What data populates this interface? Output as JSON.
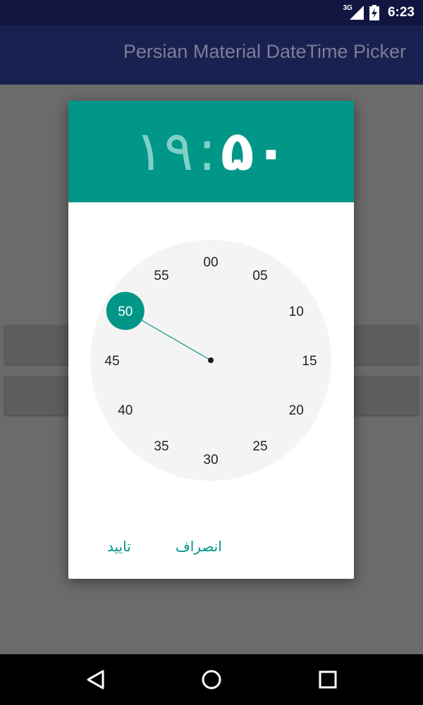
{
  "status_bar": {
    "network": "3G",
    "time": "6:23",
    "icons": [
      "signal-icon",
      "battery-charging-icon"
    ]
  },
  "app_bar": {
    "title": "Persian Material DateTime Picker"
  },
  "dialog": {
    "time": {
      "hours": "۱۹",
      "separator": ":",
      "minutes": "۵۰"
    },
    "clock": {
      "mode": "minutes",
      "labels": [
        "00",
        "05",
        "10",
        "15",
        "20",
        "25",
        "30",
        "35",
        "40",
        "45",
        "50",
        "55"
      ],
      "selected": "50",
      "selected_minute": 50
    },
    "buttons": {
      "confirm": "تایید",
      "cancel": "انصراف"
    }
  },
  "nav_bar": {
    "icons": [
      "back-icon",
      "home-icon",
      "recents-icon"
    ]
  },
  "colors": {
    "accent": "#009688",
    "status_bar": "#111640",
    "app_bar": "#1a2150",
    "clock_face": "#f4f4f4",
    "scrim": "#6b6b6b"
  }
}
